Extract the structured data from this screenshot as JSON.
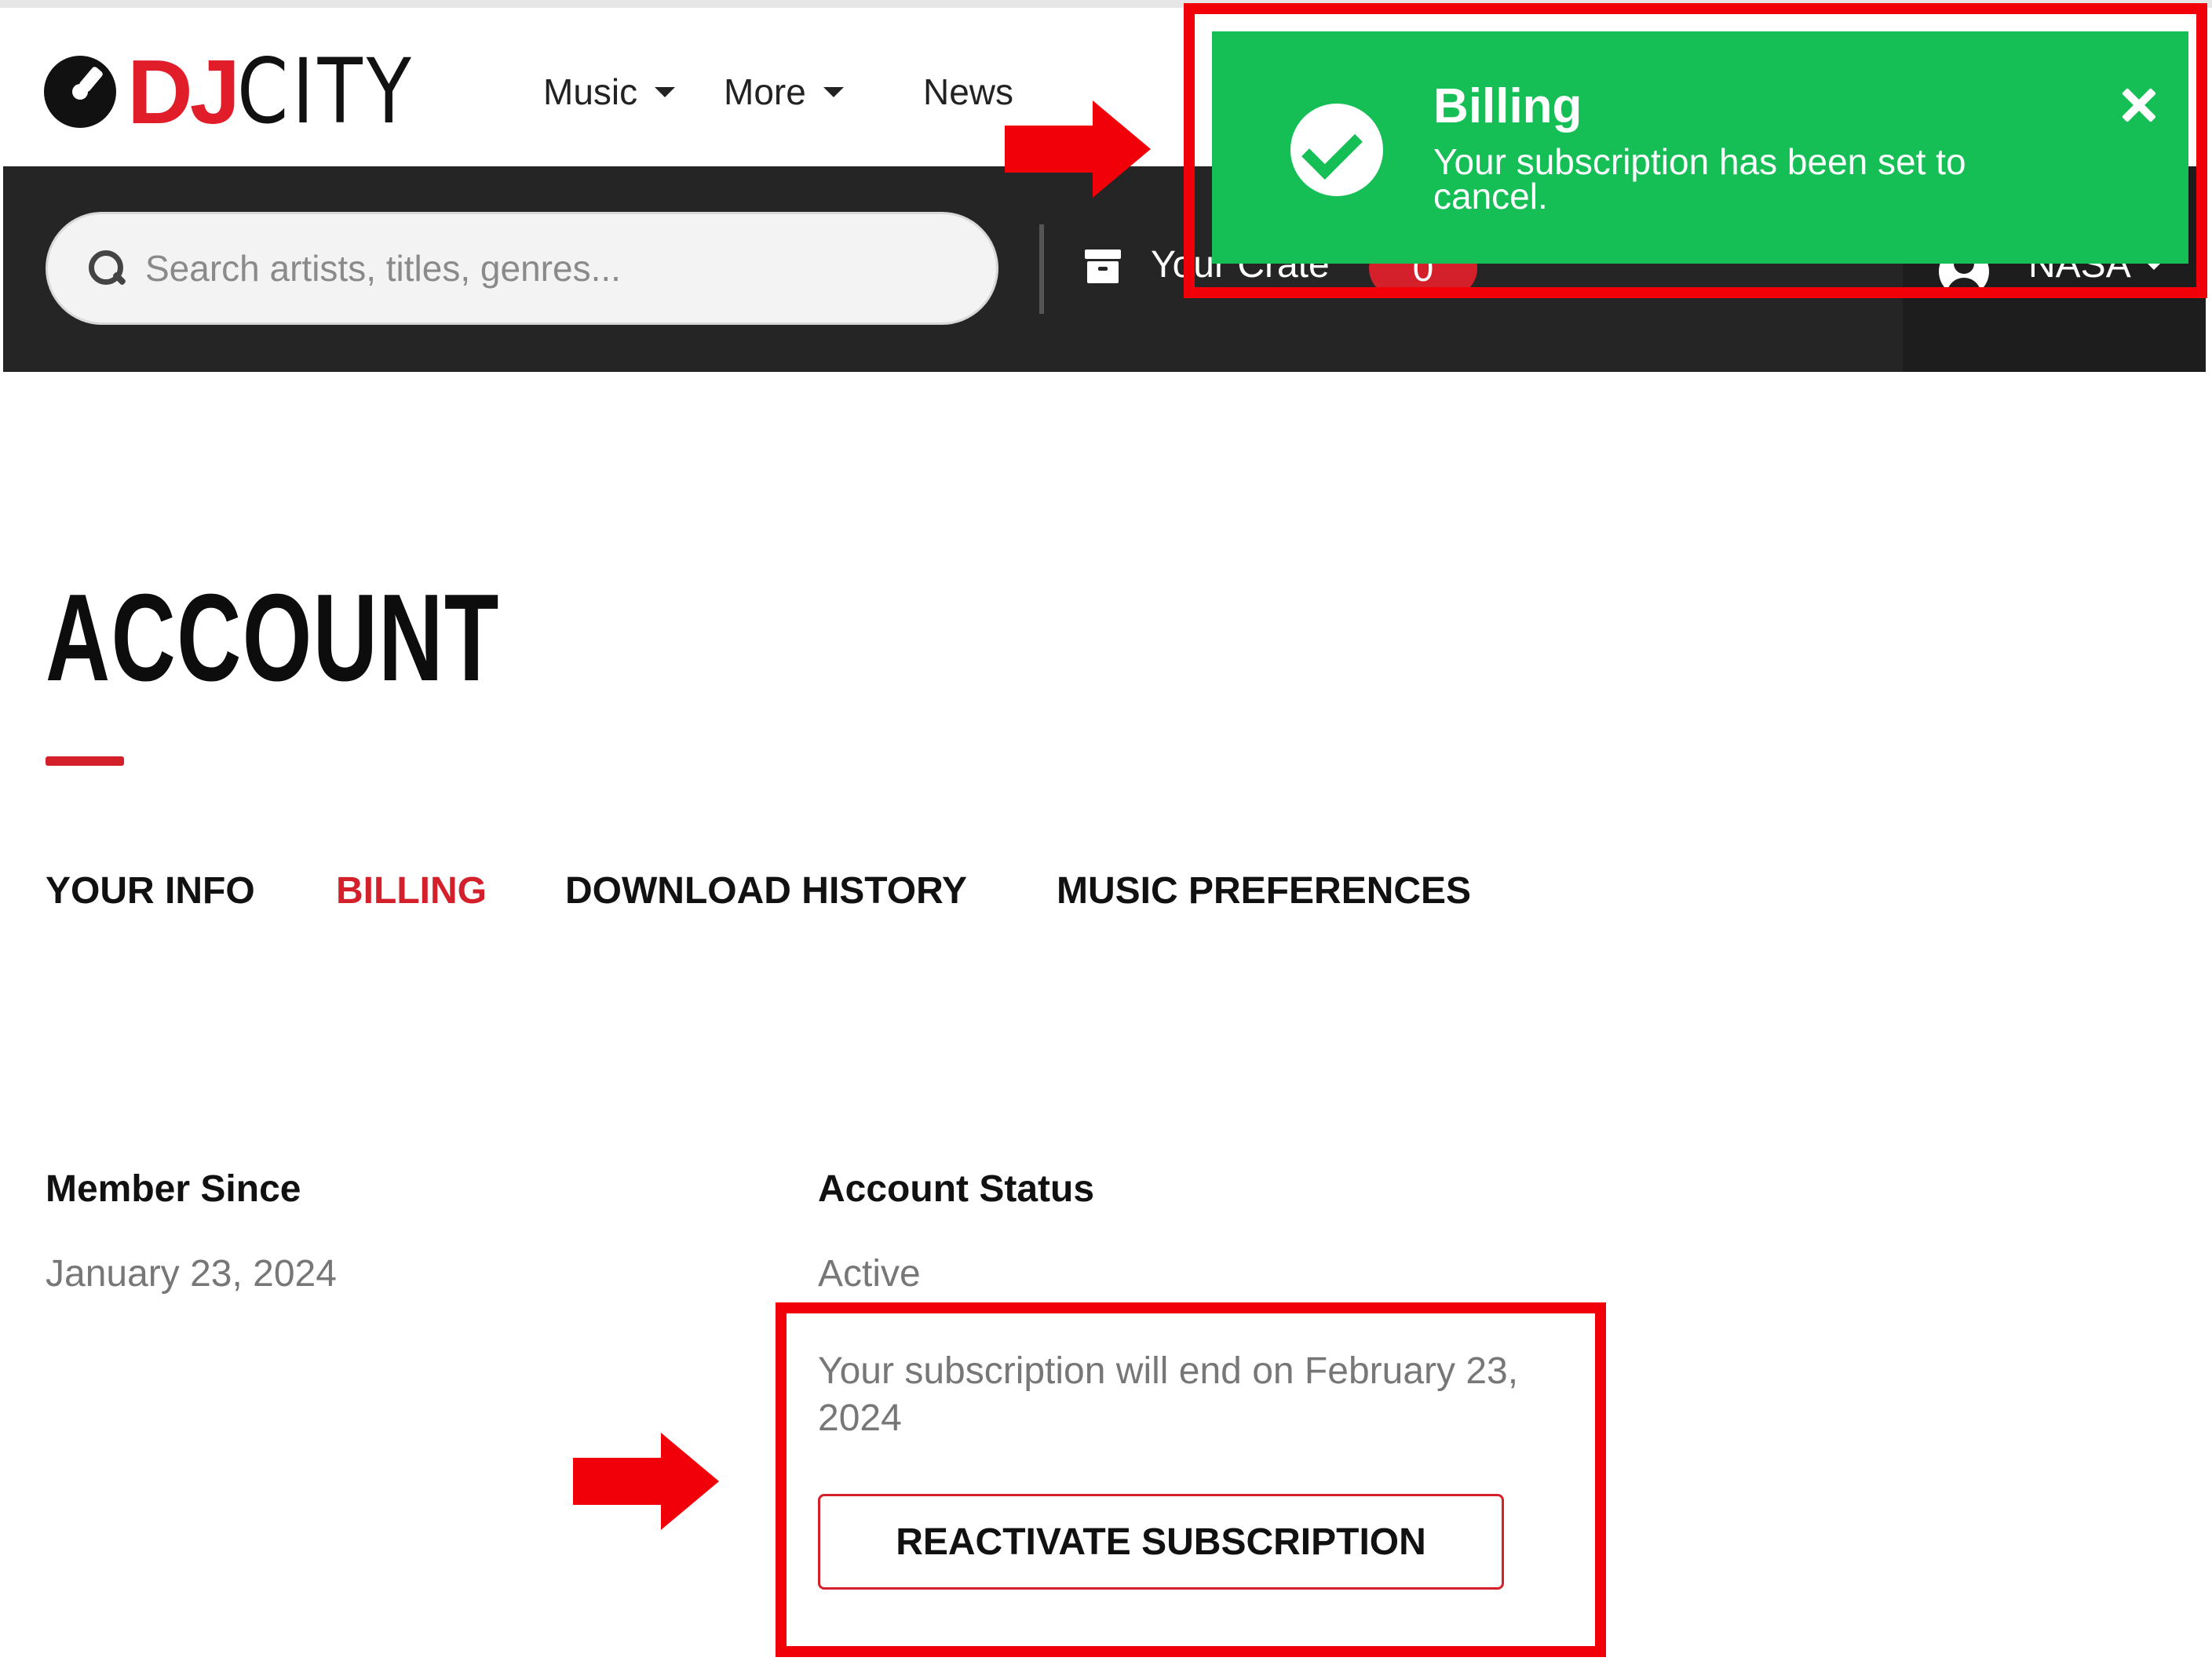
{
  "header": {
    "logo_text_dj": "DJ",
    "logo_text_city": "CITY",
    "nav": [
      {
        "label": "Music",
        "has_dropdown": true
      },
      {
        "label": "More",
        "has_dropdown": true
      },
      {
        "label": "News",
        "has_dropdown": false
      }
    ]
  },
  "toolbar": {
    "search_placeholder": "Search artists, titles, genres...",
    "crate_label": "Your Crate",
    "crate_count": "0",
    "user_name": "NASA"
  },
  "toast": {
    "title": "Billing",
    "message": "Your subscription has been set to cancel.",
    "bg_color": "#16bf56"
  },
  "page": {
    "title": "ACCOUNT",
    "tabs": [
      {
        "label": "YOUR INFO",
        "active": false
      },
      {
        "label": "BILLING",
        "active": true
      },
      {
        "label": "DOWNLOAD HISTORY",
        "active": false
      },
      {
        "label": "MUSIC PREFERENCES",
        "active": false
      }
    ],
    "member_since_label": "Member Since",
    "member_since_value": "January 23, 2024",
    "account_status_label": "Account Status",
    "account_status_value": "Active",
    "subscription_notice": "Your subscription will end on February 23, 2024",
    "reactivate_button": "REACTIVATE SUBSCRIPTION"
  },
  "colors": {
    "brand_red": "#d4202b",
    "annotation_red": "#f2000a",
    "dark_bar": "#252525"
  }
}
